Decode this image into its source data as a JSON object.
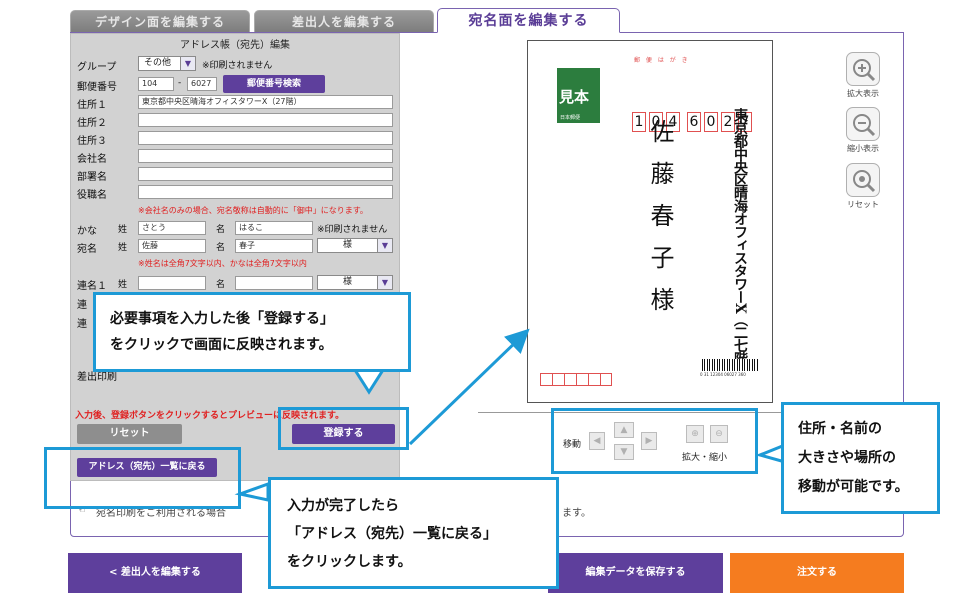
{
  "tabs": [
    {
      "label": "デザイン面を編集する"
    },
    {
      "label": "差出人を編集する"
    },
    {
      "label": "宛名面を編集する"
    }
  ],
  "form": {
    "title": "アドレス帳（宛先）編集",
    "group_label": "グループ",
    "group_value": "その他",
    "group_note": "※印刷されません",
    "zip_label": "郵便番号",
    "zip1": "104",
    "zip_sep": "-",
    "zip2": "6027",
    "zip_search": "郵便番号検索",
    "addr1_label": "住所１",
    "addr1_value": "東京都中央区晴海オフィスタワーX（27階）",
    "addr2_label": "住所２",
    "addr3_label": "住所３",
    "company_label": "会社名",
    "dept_label": "部署名",
    "title_label": "役職名",
    "company_note": "※会社名のみの場合、宛名敬称は自動的に「御中」になります。",
    "kana_label": "かな",
    "sei_label": "姓",
    "mei_label": "名",
    "kana_sei": "さとう",
    "kana_mei": "はるこ",
    "kana_note": "※印刷されません",
    "name_label": "宛名",
    "name_sei": "佐藤",
    "name_mei": "春子",
    "honorific": "様",
    "name_note": "※姓名は全角7文字以内、かなは全角7文字以内",
    "joint1_label": "連名１",
    "joint_honorific": "様",
    "joint_partial1": "連",
    "joint_partial2": "連",
    "print_partial": "差出印刷",
    "instruction": "入力後、登録ボタンをクリックするとプレビューに反映されます。",
    "reset_label": "リセット",
    "register_label": "登録する",
    "back_label": "アドレス（宛先）一覧に戻る"
  },
  "postcard": {
    "header": "郵 便 は が き",
    "zip_digits": [
      "1",
      "0",
      "4",
      "6",
      "0",
      "2",
      "7"
    ],
    "name_chars": "佐藤春子様",
    "address": "東京都中央区晴海オフィスタワーX（二七階）",
    "stamp_text": "見本",
    "stamp_sub": "日本郵便",
    "barcode_num": "0 31 12304 06027 360"
  },
  "sidebar": {
    "zoom_in": "拡大表示",
    "zoom_out": "縮小表示",
    "reset": "リセット"
  },
  "controls": {
    "move_label": "移動",
    "zoom_label": "拡大・縮小"
  },
  "notice": "宛名印刷をご利用される場合",
  "notice_tail": "ます。",
  "callouts": {
    "register": [
      "必要事項を入力した後「登録する」",
      "をクリックで画面に反映されます。"
    ],
    "back": [
      "入力が完了したら",
      "「アドレス（宛先）一覧に戻る」",
      "をクリックします。"
    ],
    "layout": [
      "住所・名前の",
      "大きさや場所の",
      "移動が可能です。"
    ]
  },
  "footer": {
    "back_label": "< 差出人を編集する",
    "save_label": "編集データを保存する",
    "order_label": "注文する"
  },
  "colors": {
    "purple": "#5e3f9c",
    "orange": "#f57c1f",
    "callout_blue": "#1d9ad6",
    "note_red": "#e02020"
  }
}
